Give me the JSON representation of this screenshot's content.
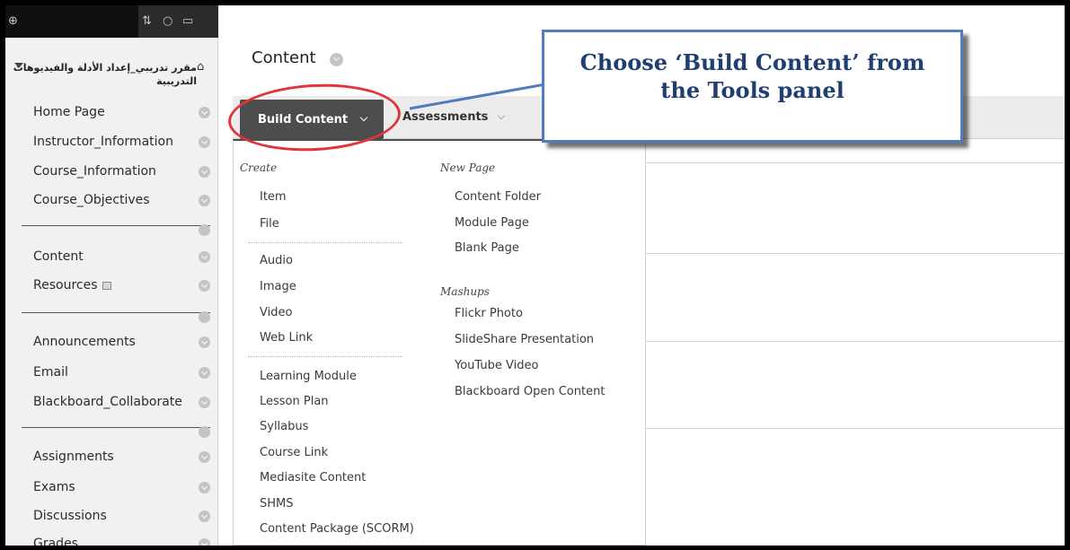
{
  "sidebar": {
    "course_title": "مقرر تدريبي_إعداد الأدلة والفيديوهات التدريبية",
    "items": [
      {
        "label": "Home Page"
      },
      {
        "label": "Instructor_Information"
      },
      {
        "label": "Course_Information"
      },
      {
        "label": "Course_Objectives"
      },
      {
        "label": "Content"
      },
      {
        "label": "Resources"
      },
      {
        "label": "Announcements"
      },
      {
        "label": "Email"
      },
      {
        "label": "Blackboard_Collaborate"
      },
      {
        "label": "Assignments"
      },
      {
        "label": "Exams"
      },
      {
        "label": "Discussions"
      },
      {
        "label": "Grades"
      }
    ]
  },
  "main": {
    "title": "Content",
    "toolbar": {
      "build_content_label": "Build Content",
      "assessments_label": "Assessments"
    }
  },
  "menu": {
    "create": {
      "heading": "Create",
      "group1": [
        "Item",
        "File"
      ],
      "group2": [
        "Audio",
        "Image",
        "Video",
        "Web Link"
      ],
      "group3": [
        "Learning Module",
        "Lesson Plan",
        "Syllabus",
        "Course Link",
        "Mediasite Content",
        "SHMS",
        "Content Package (SCORM)"
      ]
    },
    "new_page": {
      "heading": "New Page",
      "items": [
        "Content Folder",
        "Module Page",
        "Blank Page"
      ]
    },
    "mashups": {
      "heading": "Mashups",
      "items": [
        "Flickr Photo",
        "SlideShare Presentation",
        "YouTube Video",
        "Blackboard Open Content"
      ]
    }
  },
  "callout": {
    "line1": "Choose ‘Build Content’ from",
    "line2": "the Tools panel"
  },
  "colors": {
    "callout_border": "#4f7bbf",
    "callout_text": "#1f3f72",
    "highlight_ring": "#e0353a",
    "build_button": "#4d4d4d"
  }
}
